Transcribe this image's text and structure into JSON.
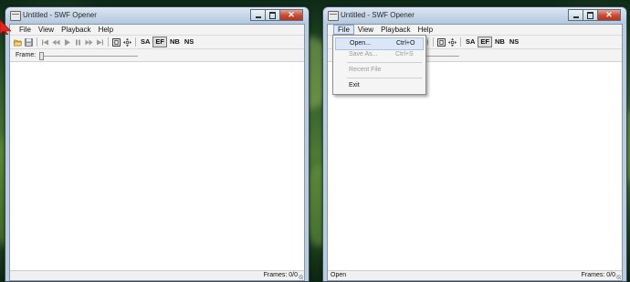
{
  "colors": {
    "arrow": "#e0251c",
    "close_button": "#c44a34",
    "titlebar": "#c8d8ea"
  },
  "left_window": {
    "title": "Untitled - SWF Opener",
    "menu": [
      "File",
      "View",
      "Playback",
      "Help"
    ],
    "toolbar": {
      "icons": [
        "open-folder-icon",
        "save-disk-icon",
        "first-frame-icon",
        "previous-frame-icon",
        "play-icon",
        "pause-icon",
        "next-frame-icon",
        "last-frame-icon",
        "border-box-icon",
        "move-arrows-icon"
      ],
      "toggles": [
        "SA",
        "EF",
        "NB",
        "NS"
      ]
    },
    "frame_label": "Frame:",
    "status_left": "",
    "status_right": "Frames: 0/0"
  },
  "right_window": {
    "title": "Untitled - SWF Opener",
    "menu": [
      "File",
      "View",
      "Playback",
      "Help"
    ],
    "toolbar": {
      "toggles": [
        "SA",
        "EF",
        "NB",
        "NS"
      ]
    },
    "file_menu": {
      "open": {
        "label": "Open...",
        "shortcut": "Ctrl+O"
      },
      "save_as": {
        "label": "Save As...",
        "shortcut": "Ctrl+S"
      },
      "recent": {
        "label": "Recent File"
      },
      "exit": {
        "label": "Exit"
      }
    },
    "status_left": "Open",
    "status_right": "Frames: 0/0"
  },
  "window_controls": {
    "close_glyph": "✕"
  }
}
